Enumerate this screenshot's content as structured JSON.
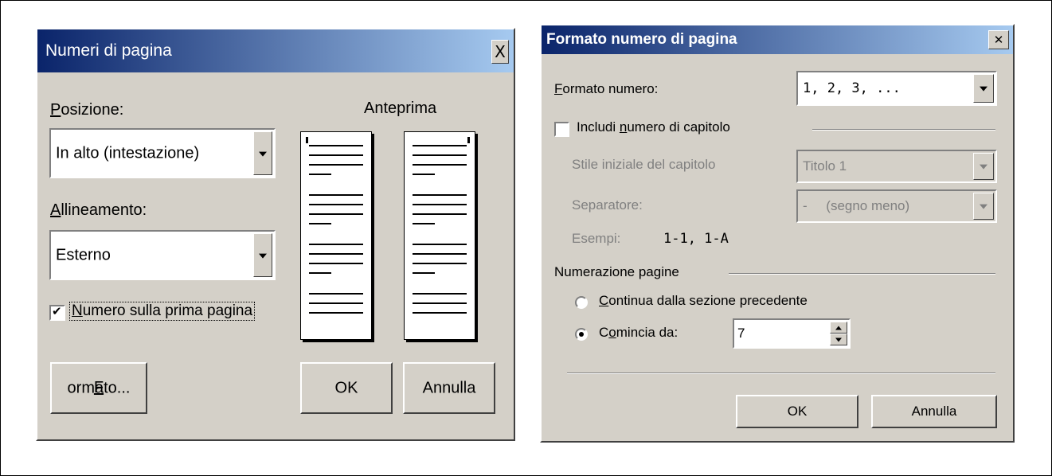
{
  "left_dialog": {
    "title": "Numeri di pagina",
    "close_glyph": "X",
    "position_label": "Posizione:",
    "position_value": "In alto (intestazione)",
    "alignment_label": "Allineamento:",
    "alignment_value": "Esterno",
    "preview_label": "Anteprima",
    "first_page_checkbox": {
      "label": "Numero sulla prima pagina",
      "checked": true,
      "mark": "✔"
    },
    "format_button": "Formato...",
    "ok_button": "OK",
    "cancel_button": "Annulla"
  },
  "right_dialog": {
    "title": "Formato numero di pagina",
    "close_glyph": "✕",
    "number_format_label": "Formato numero:",
    "number_format_value": "1, 2, 3, ...",
    "include_chapter_label": "Includi numero di capitolo",
    "include_chapter_checked": false,
    "chapter_style_label": "Stile iniziale del capitolo",
    "chapter_style_value": "Titolo 1",
    "separator_label": "Separatore:",
    "separator_value": "-     (segno meno)",
    "examples_label": "Esempi:",
    "examples_value": "1-1, 1-A",
    "page_numbering_label": "Numerazione pagine",
    "continue_radio_label": "Continua dalla sezione precedente",
    "start_at_radio_label": "Comincia da:",
    "start_at_value": "7",
    "selected_radio": "start_at",
    "ok_button": "OK",
    "cancel_button": "Annulla"
  },
  "colors": {
    "dialog_face": "#d4d0c8",
    "title_start": "#0a246a",
    "title_end": "#a6caf0"
  }
}
